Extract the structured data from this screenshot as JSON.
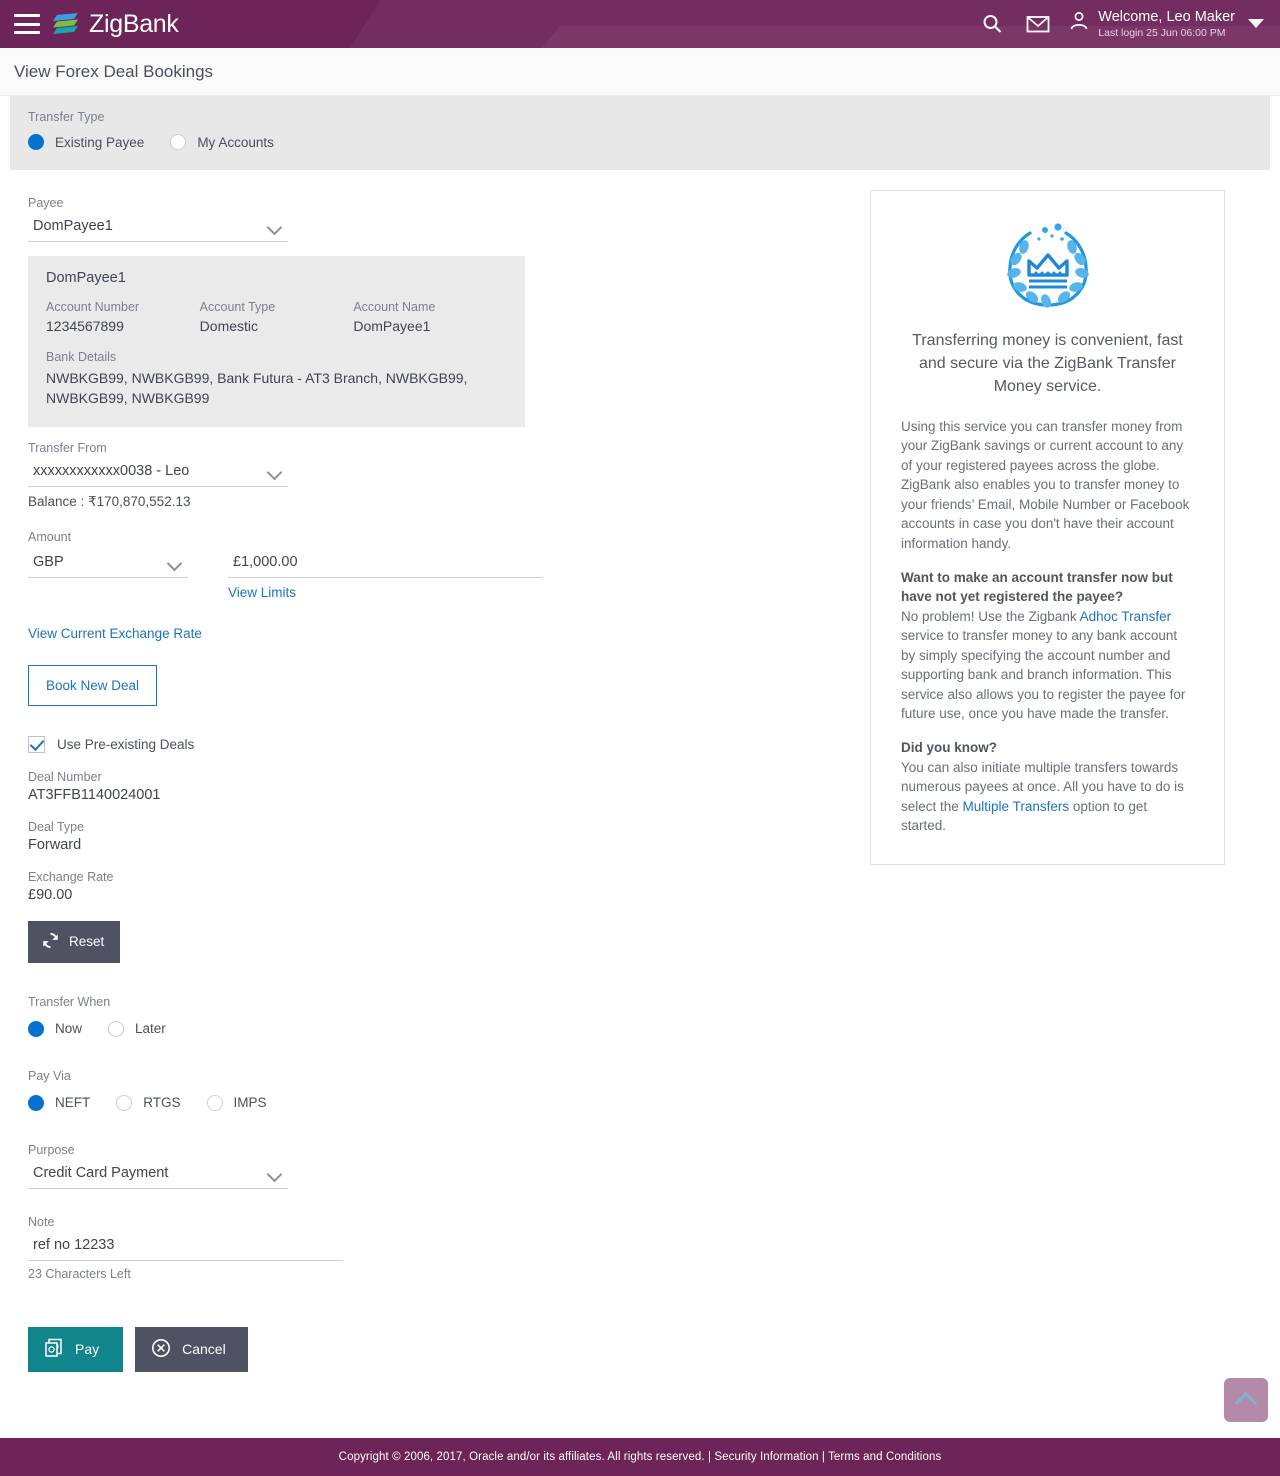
{
  "header": {
    "brand": "ZigBank",
    "menu_icon": "hamburger-icon",
    "search_icon": "search-icon",
    "mail_icon": "mail-icon",
    "user_icon": "user-avatar-icon",
    "welcome": "Welcome, Leo Maker",
    "last_login": "Last login 25 Jun 06:00 PM",
    "brand_color": "#6d2459"
  },
  "page": {
    "title": "View Forex Deal Bookings"
  },
  "transfer_type": {
    "label": "Transfer Type",
    "options": [
      {
        "label": "Existing Payee",
        "selected": true
      },
      {
        "label": "My Accounts",
        "selected": false
      }
    ]
  },
  "form": {
    "payee": {
      "label": "Payee",
      "value": "DomPayee1"
    },
    "payee_card": {
      "title": "DomPayee1",
      "account_number_label": "Account Number",
      "account_number_value": "1234567899",
      "account_type_label": "Account Type",
      "account_type_value": "Domestic",
      "account_name_label": "Account Name",
      "account_name_value": "DomPayee1",
      "bank_details_label": "Bank Details",
      "bank_details_value": "NWBKGB99, NWBKGB99, Bank Futura - AT3 Branch, NWBKGB99, NWBKGB99, NWBKGB99"
    },
    "transfer_from": {
      "label": "Transfer From",
      "value": "xxxxxxxxxxxx0038 - Leo",
      "balance": "Balance : ₹170,870,552.13"
    },
    "amount": {
      "label": "Amount",
      "currency": "GBP",
      "value": "£1,000.00",
      "view_limits_link": "View Limits"
    },
    "exchange_rate_link": "View Current Exchange Rate",
    "book_new_deal_button": "Book New Deal",
    "use_pre_existing": {
      "label": "Use Pre-existing Deals",
      "checked": true
    },
    "deal_number": {
      "label": "Deal Number",
      "value": "AT3FFB1140024001"
    },
    "deal_type": {
      "label": "Deal Type",
      "value": "Forward"
    },
    "deal_exchange_rate": {
      "label": "Exchange Rate",
      "value": "£90.00"
    },
    "reset_button": "Reset",
    "transfer_when": {
      "label": "Transfer When",
      "options": [
        {
          "label": "Now",
          "selected": true
        },
        {
          "label": "Later",
          "selected": false
        }
      ]
    },
    "pay_via": {
      "label": "Pay Via",
      "options": [
        {
          "label": "NEFT",
          "selected": true
        },
        {
          "label": "RTGS",
          "selected": false
        },
        {
          "label": "IMPS",
          "selected": false
        }
      ]
    },
    "purpose": {
      "label": "Purpose",
      "value": "Credit Card Payment"
    },
    "note": {
      "label": "Note",
      "value": "ref no 12233",
      "help": "23 Characters Left"
    },
    "pay_button": "Pay",
    "cancel_button": "Cancel",
    "pay_icon": "money-note-icon",
    "cancel_icon": "circle-x-icon",
    "reset_icon": "refresh-icon"
  },
  "info_panel": {
    "logo_icon": "crown-laurel-icon",
    "headline": "Transferring money is convenient, fast and secure via the ZigBank Transfer Money service.",
    "paragraph1": "Using this service you can transfer money from your ZigBank savings or current account to any of your registered payees across the globe. ZigBank also enables you to transfer money to your friends’ Email, Mobile Number or Facebook accounts in case you don't have their account information handy.",
    "heading2": "Want to make an account transfer now but have not yet registered the payee?",
    "para2_before": "No problem! Use the Zigbank ",
    "para2_link": "Adhoc Transfer",
    "para2_after": " service to transfer money to any bank account by simply specifying the account number and supporting bank and branch information. This service also allows you to register the payee for future use, once you have made the transfer.",
    "heading3": "Did you know?",
    "para3_before": "You can also initiate multiple transfers towards numerous payees at once. All you have to do is select the ",
    "para3_link": "Multiple Transfers",
    "para3_after": " option to get started."
  },
  "scroll_top": {
    "icon": "chevron-up-icon"
  },
  "footer": {
    "copyright": "Copyright © 2006, 2017, Oracle and/or its affiliates. All rights reserved.",
    "sep1": "|",
    "security_link": "Security Information",
    "sep2": "|",
    "terms_link": "Terms and Conditions"
  }
}
